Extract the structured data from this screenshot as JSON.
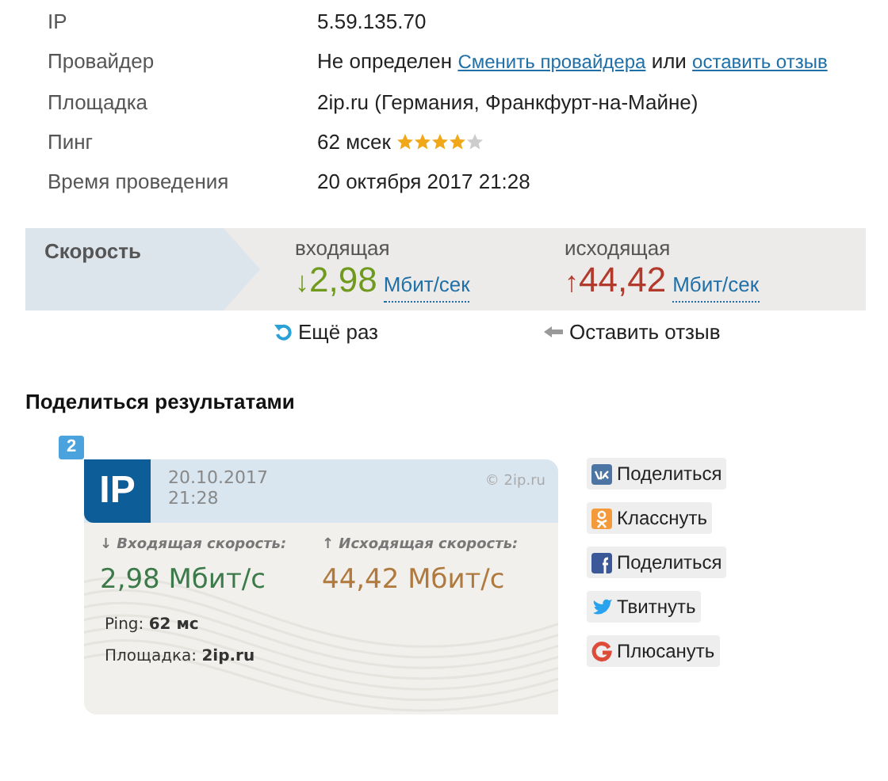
{
  "info": [
    {
      "label": "IP",
      "value": "5.59.135.70"
    },
    {
      "label": "Провайдер",
      "value": "Не определен",
      "link_1": "Сменить провайдера",
      "joiner": "или",
      "link_2": "оставить отзыв"
    },
    {
      "label": "Площадка",
      "value": "2ip.ru (Германия, Франкфурт-на-Майне)"
    },
    {
      "label": "Пинг",
      "value": "62 мсек",
      "stars": 4
    },
    {
      "label": "Время проведения",
      "value": "20 октября 2017 21:28"
    }
  ],
  "speed": {
    "title": "Скорость",
    "incoming": {
      "label": "входящая",
      "arrow": "↓",
      "value": "2,98",
      "unit": "Мбит/сек"
    },
    "outgoing": {
      "label": "исходящая",
      "arrow": "↑",
      "value": "44,42",
      "unit": "Мбит/сек"
    },
    "retry": "Ещё раз",
    "feedback": "Оставить отзыв"
  },
  "share": {
    "heading": "Поделиться результатами",
    "badge": "2",
    "card": {
      "logo": "IP",
      "date": "20.10.2017",
      "time": "21:28",
      "copyright": "© 2ip.ru",
      "in_label": "↓ Входящая скорость:",
      "out_label": "↑ Исходящая скорость:",
      "in_value": "2,98 Мбит/с",
      "out_value": "44,42 Мбит/с",
      "ping_label": "Ping:",
      "ping_value": "62 мс",
      "site_label": "Площадка:",
      "site_value": "2ip.ru"
    },
    "buttons": [
      {
        "kind": "vk",
        "label": "Поделиться"
      },
      {
        "kind": "ok",
        "label": "Класснуть"
      },
      {
        "kind": "fb",
        "label": "Поделиться"
      },
      {
        "kind": "tw",
        "label": "Твитнуть"
      },
      {
        "kind": "gp",
        "label": "Плюсануть"
      }
    ]
  }
}
